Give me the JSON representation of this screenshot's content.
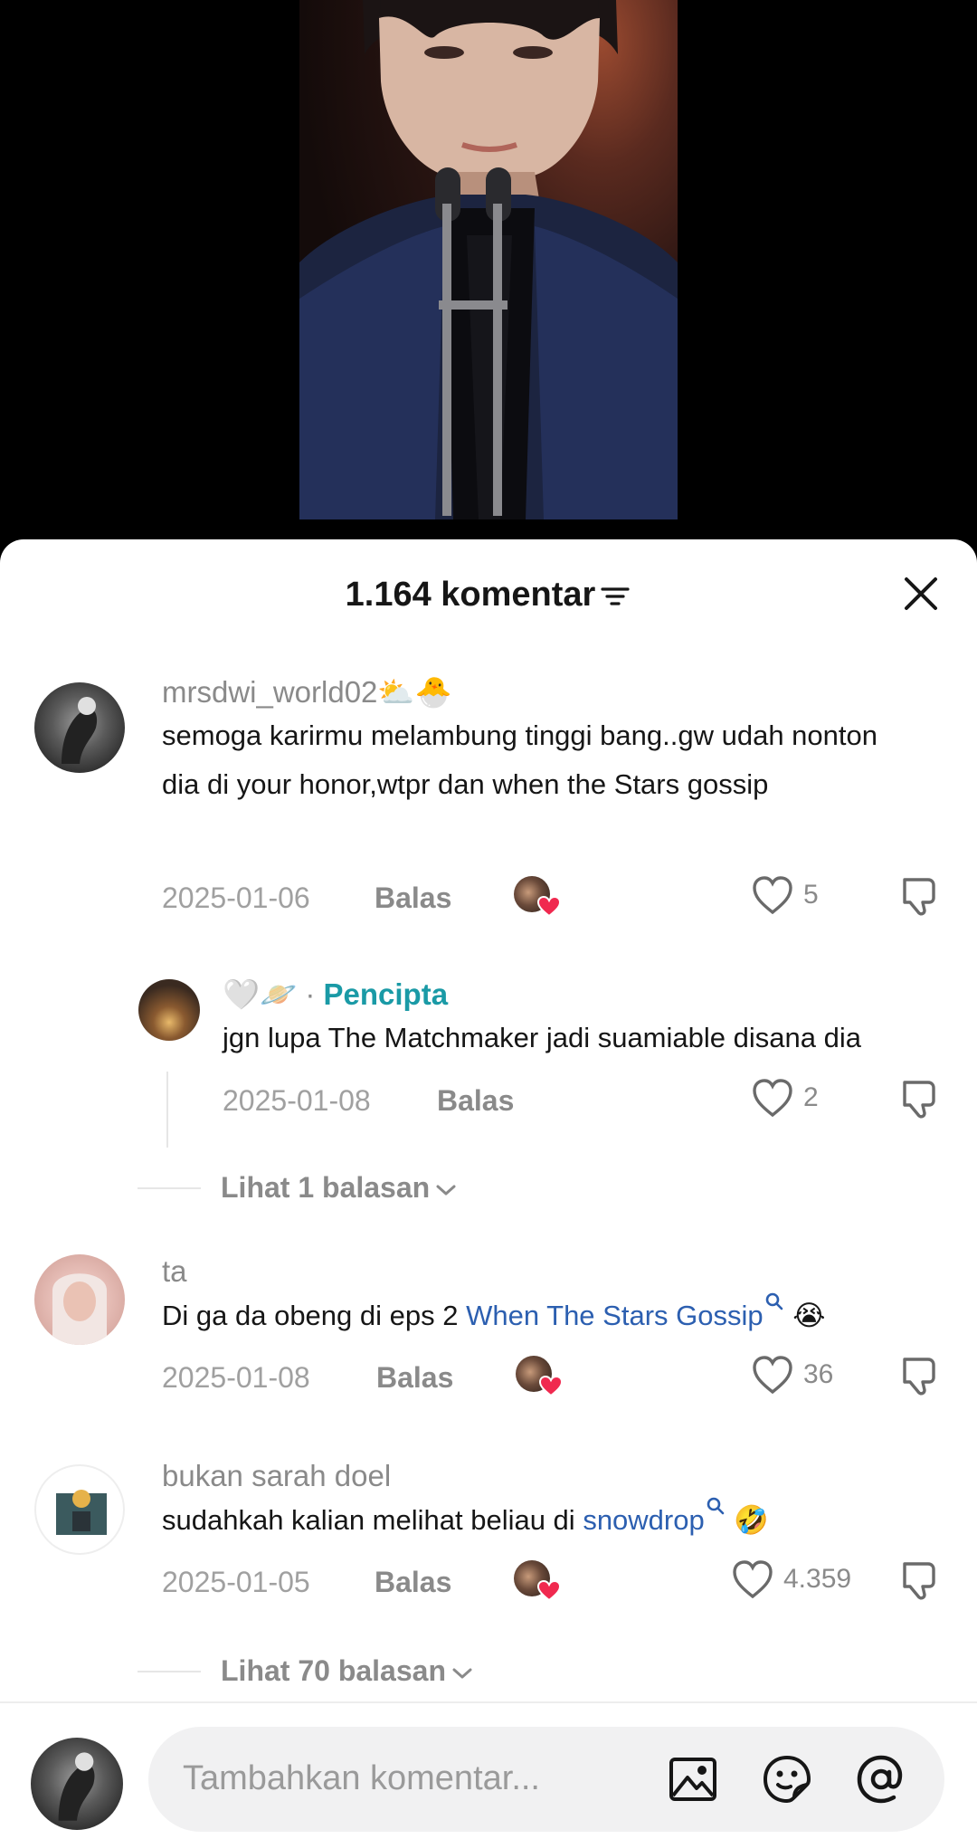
{
  "header": {
    "comment_count": "1.164 komentar"
  },
  "comments": [
    {
      "username": "mrsdwi_world02",
      "username_emoji": "⛅🐣",
      "text": "semoga karirmu melambung tinggi bang..gw udah nonton dia di your honor,wtpr dan when the Stars gossip",
      "date": "2025-01-06",
      "reply_label": "Balas",
      "likes": "5"
    },
    {
      "username_emoji": "🤍🪐",
      "separator": " · ",
      "creator_label": "Pencipta",
      "text": "jgn lupa The Matchmaker jadi suamiable disana dia",
      "date": "2025-01-08",
      "reply_label": "Balas",
      "likes": "2"
    },
    {
      "username": "ta",
      "text_before": "Di ga da obeng di eps 2 ",
      "link": "When The Stars Gossip",
      "emoji": "😭",
      "date": "2025-01-08",
      "reply_label": "Balas",
      "likes": "36"
    },
    {
      "username": "bukan sarah doel",
      "text_before": "sudahkah kalian melihat beliau di ",
      "link": "snowdrop",
      "emoji": "🤣",
      "date": "2025-01-05",
      "reply_label": "Balas",
      "likes": "4.359"
    }
  ],
  "view_replies_1": "Lihat 1 balasan",
  "view_replies_2": "Lihat 70 balasan",
  "input": {
    "placeholder": "Tambahkan komentar..."
  },
  "colors": {
    "creator_tag": "#1a9aa6",
    "link": "#2c5fb0",
    "heart_red": "#f0294f"
  }
}
